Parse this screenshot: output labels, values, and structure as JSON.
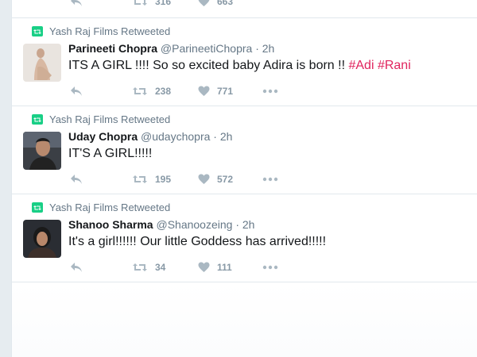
{
  "partial_tweet": {
    "retweets": "316",
    "likes": "663"
  },
  "tweets": [
    {
      "context": "Yash Raj Films Retweeted",
      "name": "Parineeti Chopra",
      "handle": "@ParineetiChopra",
      "time": "· 2h",
      "text": "ITS A GIRL !!!! So so excited baby Adira is born !! ",
      "hashtags": [
        "#Adi",
        "#Rani"
      ],
      "retweets": "238",
      "likes": "771"
    },
    {
      "context": "Yash Raj Films Retweeted",
      "name": "Uday Chopra",
      "handle": "@udaychopra",
      "time": "· 2h",
      "text": "IT'S A GIRL!!!!!",
      "retweets": "195",
      "likes": "572"
    },
    {
      "context": "Yash Raj Films Retweeted",
      "name": "Shanoo Sharma",
      "handle": "@Shanoozeing",
      "time": "· 2h",
      "text": "It's a girl!!!!!! Our little Goddess has arrived!!!!!",
      "retweets": "34",
      "likes": "111"
    }
  ],
  "colors": {
    "retweet_green": "#19cf86",
    "hashtag": "#e0245e",
    "muted": "#657786"
  },
  "icons": [
    "retweet-icon",
    "reply-icon",
    "heart-icon",
    "more-icon"
  ]
}
